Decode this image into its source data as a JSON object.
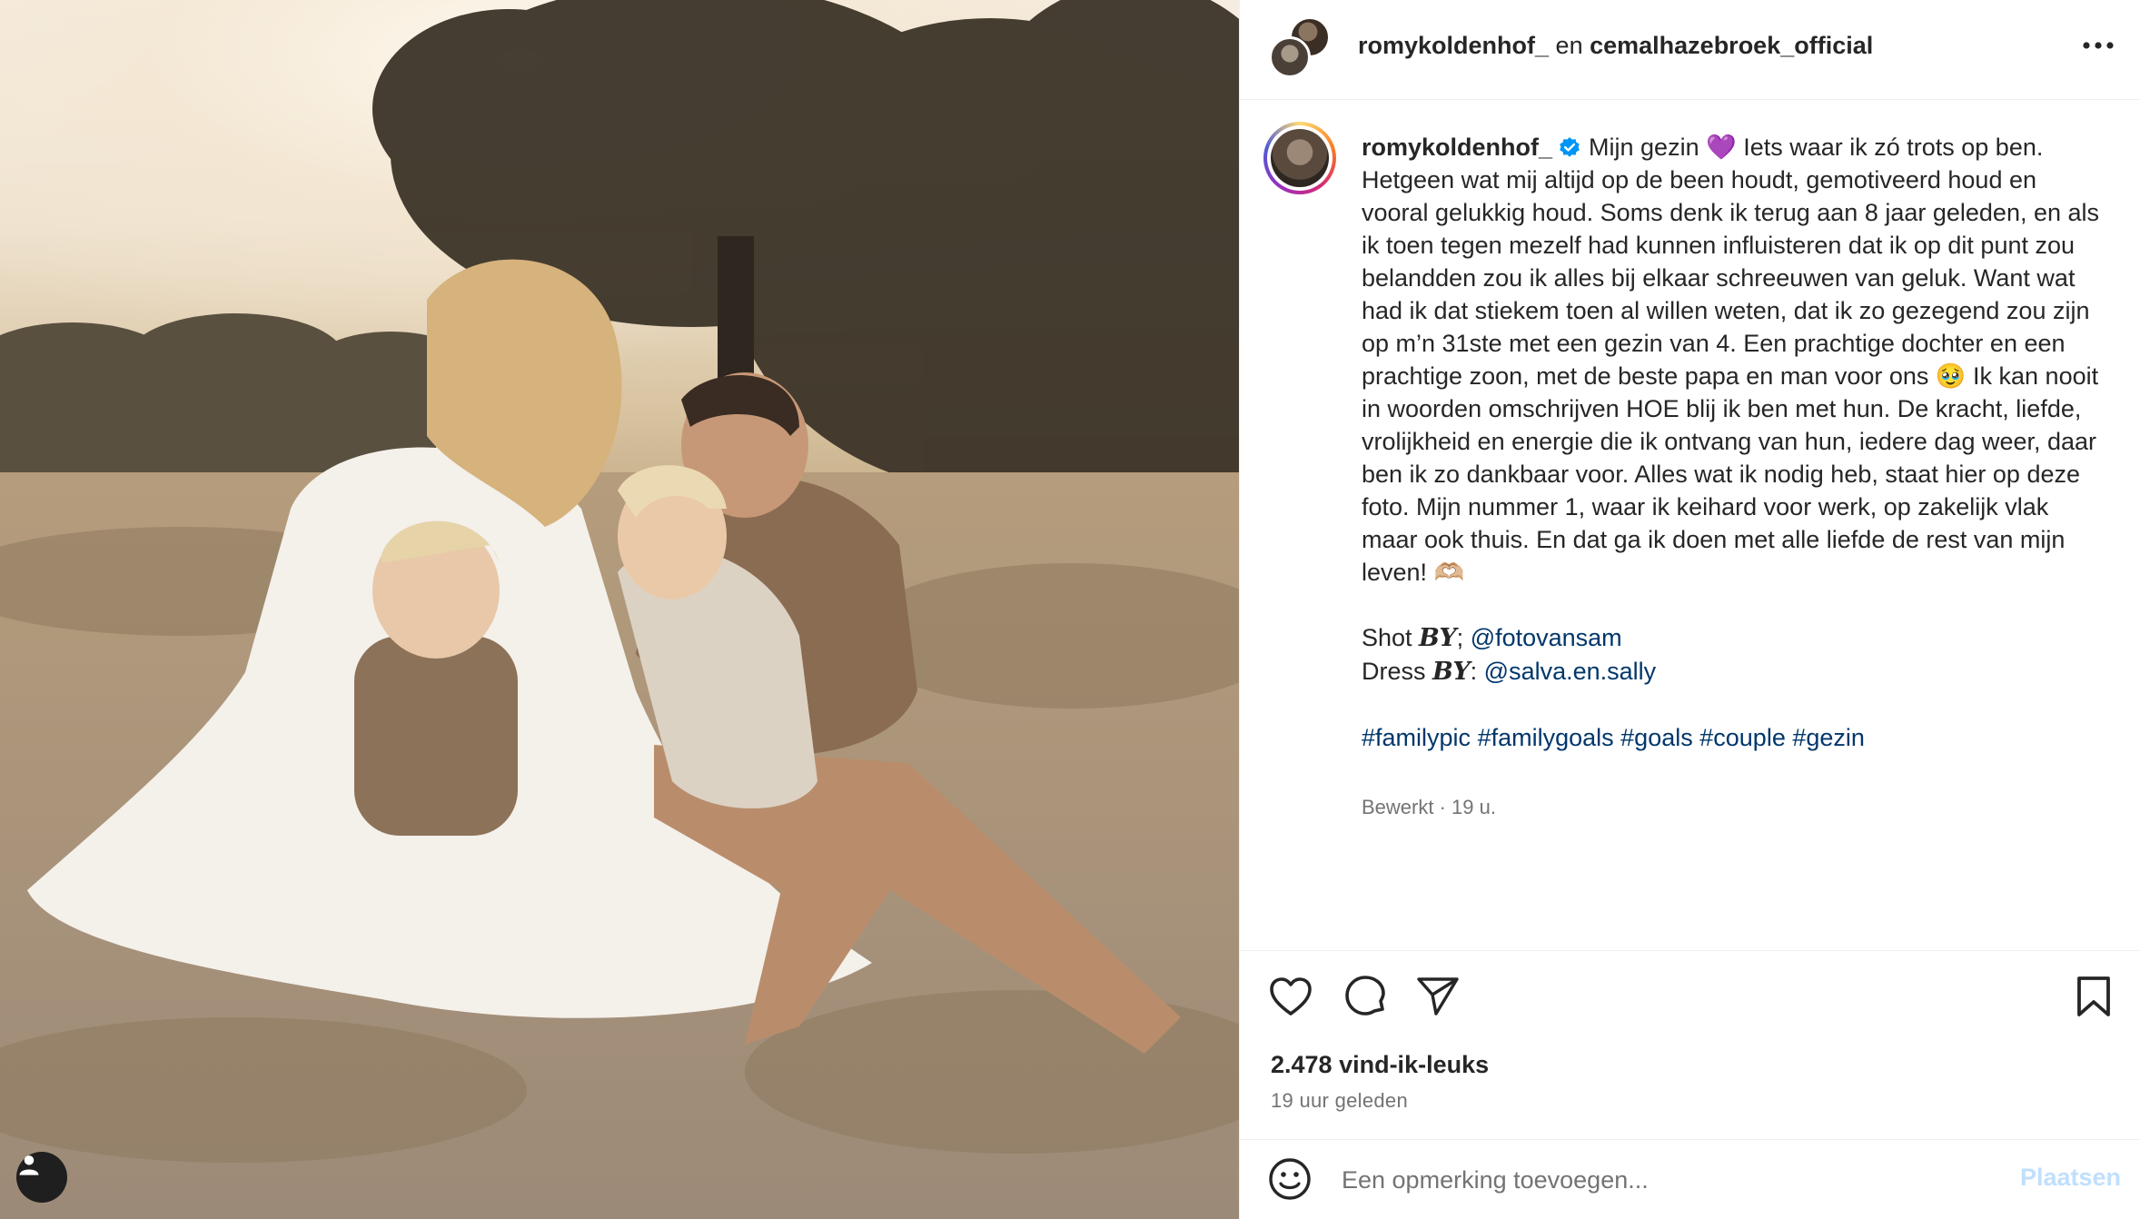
{
  "post": {
    "header": {
      "author": "romykoldenhof_",
      "conjunction": "en",
      "collaborator": "cemalhazebroek_official"
    },
    "caption": {
      "author": "romykoldenhof_",
      "text_1": "Mijn gezin 💜 Iets waar ik zó trots op ben. Hetgeen wat mij altijd op de been houdt, gemotiveerd houd en vooral gelukkig houd. Soms denk ik terug aan 8 jaar geleden, en als ik toen tegen mezelf had kunnen influisteren dat ik op dit punt zou belandden zou ik alles bij elkaar schreeuwen van geluk. Want wat had ik dat stiekem toen al willen weten, dat ik zo gezegend zou zijn op m’n 31ste met een gezin van 4. Een prachtige dochter en een prachtige zoon, met de beste papa en man voor ons 🥹 Ik kan nooit in woorden omschrijven HOE blij ik ben met hun. De kracht, liefde, vrolijkheid en energie die ik ontvang van hun, iedere dag weer, daar ben ik zo dankbaar voor. Alles wat ik nodig heb, staat hier op deze foto. Mijn nummer 1, waar ik keihard voor werk, op zakelijk vlak maar ook thuis. En dat ga ik doen met alle liefde de rest van mijn leven! 🫶🏼",
      "credit_1_prefix": "Shot ",
      "credit_1_by": "BY",
      "credit_1_sep": "; ",
      "credit_1_handle": "@fotovansam",
      "credit_2_prefix": "Dress ",
      "credit_2_by": "BY",
      "credit_2_sep": ": ",
      "credit_2_handle": "@salva.en.sally",
      "hashtags": [
        "#familypic",
        "#familygoals",
        "#goals",
        "#couple",
        "#gezin"
      ]
    },
    "meta": "Bewerkt · 19 u.",
    "likes": "2.478 vind-ik-leuks",
    "time_ago": "19 uur geleden",
    "comment": {
      "placeholder": "Een opmerking toevoegen...",
      "post_label": "Plaatsen"
    }
  },
  "icons": {
    "more": "more-options-icon",
    "like": "heart-icon",
    "comment": "comment-bubble-icon",
    "share": "paper-plane-icon",
    "save": "bookmark-icon",
    "emoji": "emoji-smiley-icon",
    "user_tags": "user-tag-icon",
    "verified": "verified-badge-icon"
  },
  "colors": {
    "text": "#262626",
    "secondary": "#737373",
    "link": "#00376b",
    "verified": "#0095f6",
    "post_disabled": "#c0dffd"
  }
}
